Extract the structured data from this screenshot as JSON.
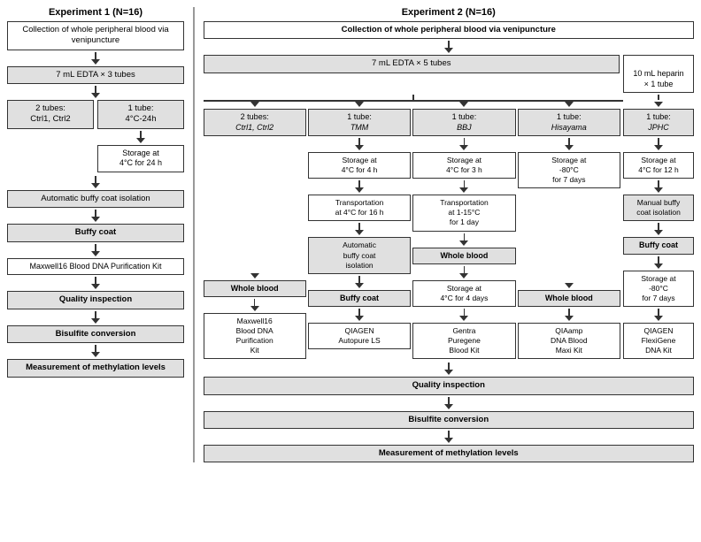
{
  "exp1": {
    "title": "Experiment 1 (N=16)",
    "step1": "Collection of whole peripheral blood via venipuncture",
    "step2": "7 mL EDTA × 3 tubes",
    "tube1": "2 tubes:\nCtrl1, Ctrl2",
    "tube2": "1 tube:\n4°C-24h",
    "storage1": "Storage at\n4°C for 24 h",
    "step3": "Automatic buffy coat isolation",
    "step4": "Buffy coat",
    "step5": "Maxwell16 Blood DNA\nPurification Kit",
    "step6": "Quality inspection",
    "step7": "Bisulfite conversion",
    "step8": "Measurement of methylation levels"
  },
  "exp2": {
    "title": "Experiment 2 (N=16)",
    "step1": "Collection of whole peripheral blood via venipuncture",
    "step2_edta": "7 mL EDTA × 5 tubes",
    "step2_heparin": "10 mL heparin\n× 1 tube",
    "branches": [
      {
        "id": "ctrl",
        "label": "2 tubes:\nCtrl1, Ctrl2",
        "storage": "",
        "transport": "",
        "auto_isolation": "",
        "result_type": "Whole blood",
        "result_storage": "",
        "kit": "Maxwell16\nBlood DNA\nPurification\nKit"
      },
      {
        "id": "tmm",
        "label": "1 tube:\nTMM",
        "storage": "Storage at\n4°C for 4 h",
        "transport": "Transportation\nat 4°C for 16 h",
        "auto_isolation": "Automatic\nbuffy coat\nisolation",
        "result_type": "Buffy coat",
        "result_storage": "",
        "kit": "QIAGEN\nAutopure LS"
      },
      {
        "id": "bbj",
        "label": "1 tube:\nBBJ",
        "storage": "Storage at\n4°C for 3 h",
        "transport": "Transportation\nat 1-15°C\nfor 1 day",
        "auto_isolation": "",
        "result_type": "Whole blood",
        "result_storage": "Storage at\n4°C for 4 days",
        "kit": "Gentra\nPuregene\nBlood Kit"
      },
      {
        "id": "hisayama",
        "label": "1 tube:\nHisayama",
        "storage": "Storage at\n-80°C\nfor 7 days",
        "transport": "",
        "auto_isolation": "",
        "result_type": "Whole blood",
        "result_storage": "",
        "kit": "QIAamp\nDNA Blood\nMaxi Kit"
      },
      {
        "id": "jphc",
        "label": "1 tube:\nJPHC",
        "storage": "Storage at\n4°C for 12 h",
        "transport": "",
        "auto_isolation": "Manual buffy\ncoat isolation",
        "result_type": "Buffy coat",
        "result_storage": "Storage at\n-80°C\nfor 7 days",
        "kit": "QIAGEN\nFlexiGene\nDNA Kit"
      }
    ],
    "step6": "Quality inspection",
    "step7": "Bisulfite conversion",
    "step8": "Measurement of methylation levels"
  }
}
